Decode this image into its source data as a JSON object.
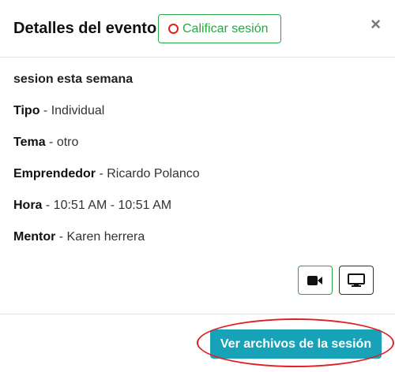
{
  "header": {
    "title": "Detalles del evento",
    "rate_button_label": "Calificar sesión",
    "close_symbol": "×"
  },
  "event": {
    "name": "sesion esta semana",
    "details": [
      {
        "label": "Tipo",
        "value": " - Individual"
      },
      {
        "label": "Tema",
        "value": " - otro"
      },
      {
        "label": "Emprendedor",
        "value": " - Ricardo Polanco"
      },
      {
        "label": "Hora",
        "value": " - 10:51 AM - 10:51 AM"
      },
      {
        "label": "Mentor",
        "value": " - Karen herrera"
      }
    ]
  },
  "actions": {
    "video_icon": "video-camera-icon",
    "screen_icon": "monitor-icon"
  },
  "footer": {
    "files_button_label": "Ver archivos de la sesión"
  },
  "colors": {
    "success": "#28a745",
    "info": "#17a2b8",
    "annotation": "#e02020"
  }
}
